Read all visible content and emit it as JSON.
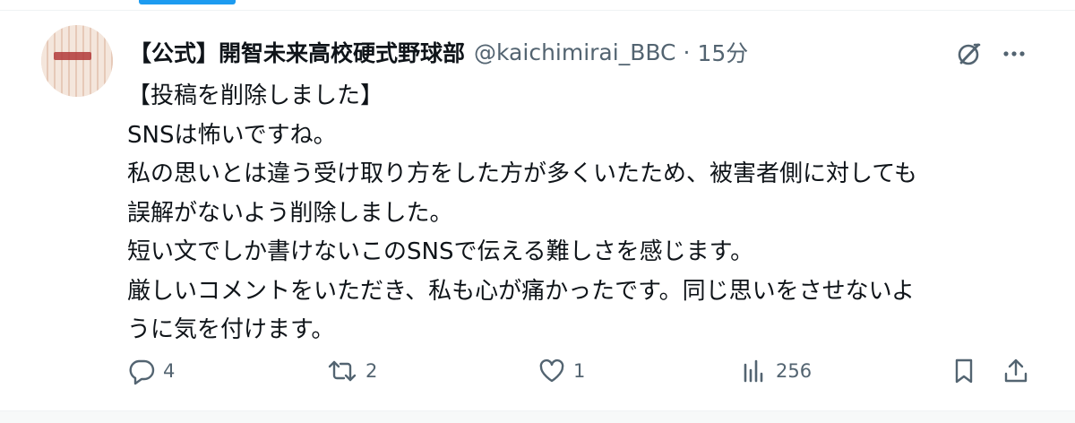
{
  "tweet": {
    "display_name": "【公式】開智未来高校硬式野球部",
    "handle": "@kaichimirai_BBC",
    "separator": "·",
    "time": "15分",
    "lines": [
      "【投稿を削除しました】",
      "SNSは怖いですね。",
      "私の思いとは違う受け取り方をした方が多くいたため、被害者側に対しても",
      "誤解がないよう削除しました。",
      "短い文でしか書けないこのSNSで伝える難しさを感じます。",
      "厳しいコメントをいただき、私も心が痛かったです。同じ思いをさせないよ",
      "うに気を付けます。"
    ]
  },
  "actions": {
    "reply": {
      "icon": "reply-icon",
      "count": "4"
    },
    "retweet": {
      "icon": "retweet-icon",
      "count": "2"
    },
    "like": {
      "icon": "heart-icon",
      "count": "1"
    },
    "views": {
      "icon": "views-icon",
      "count": "256"
    },
    "bookmark": {
      "icon": "bookmark-icon"
    },
    "share": {
      "icon": "share-icon"
    }
  },
  "colors": {
    "text": "#0f1419",
    "secondary": "#536471",
    "accent": "#1d9bf0",
    "divider": "#eff3f4"
  }
}
